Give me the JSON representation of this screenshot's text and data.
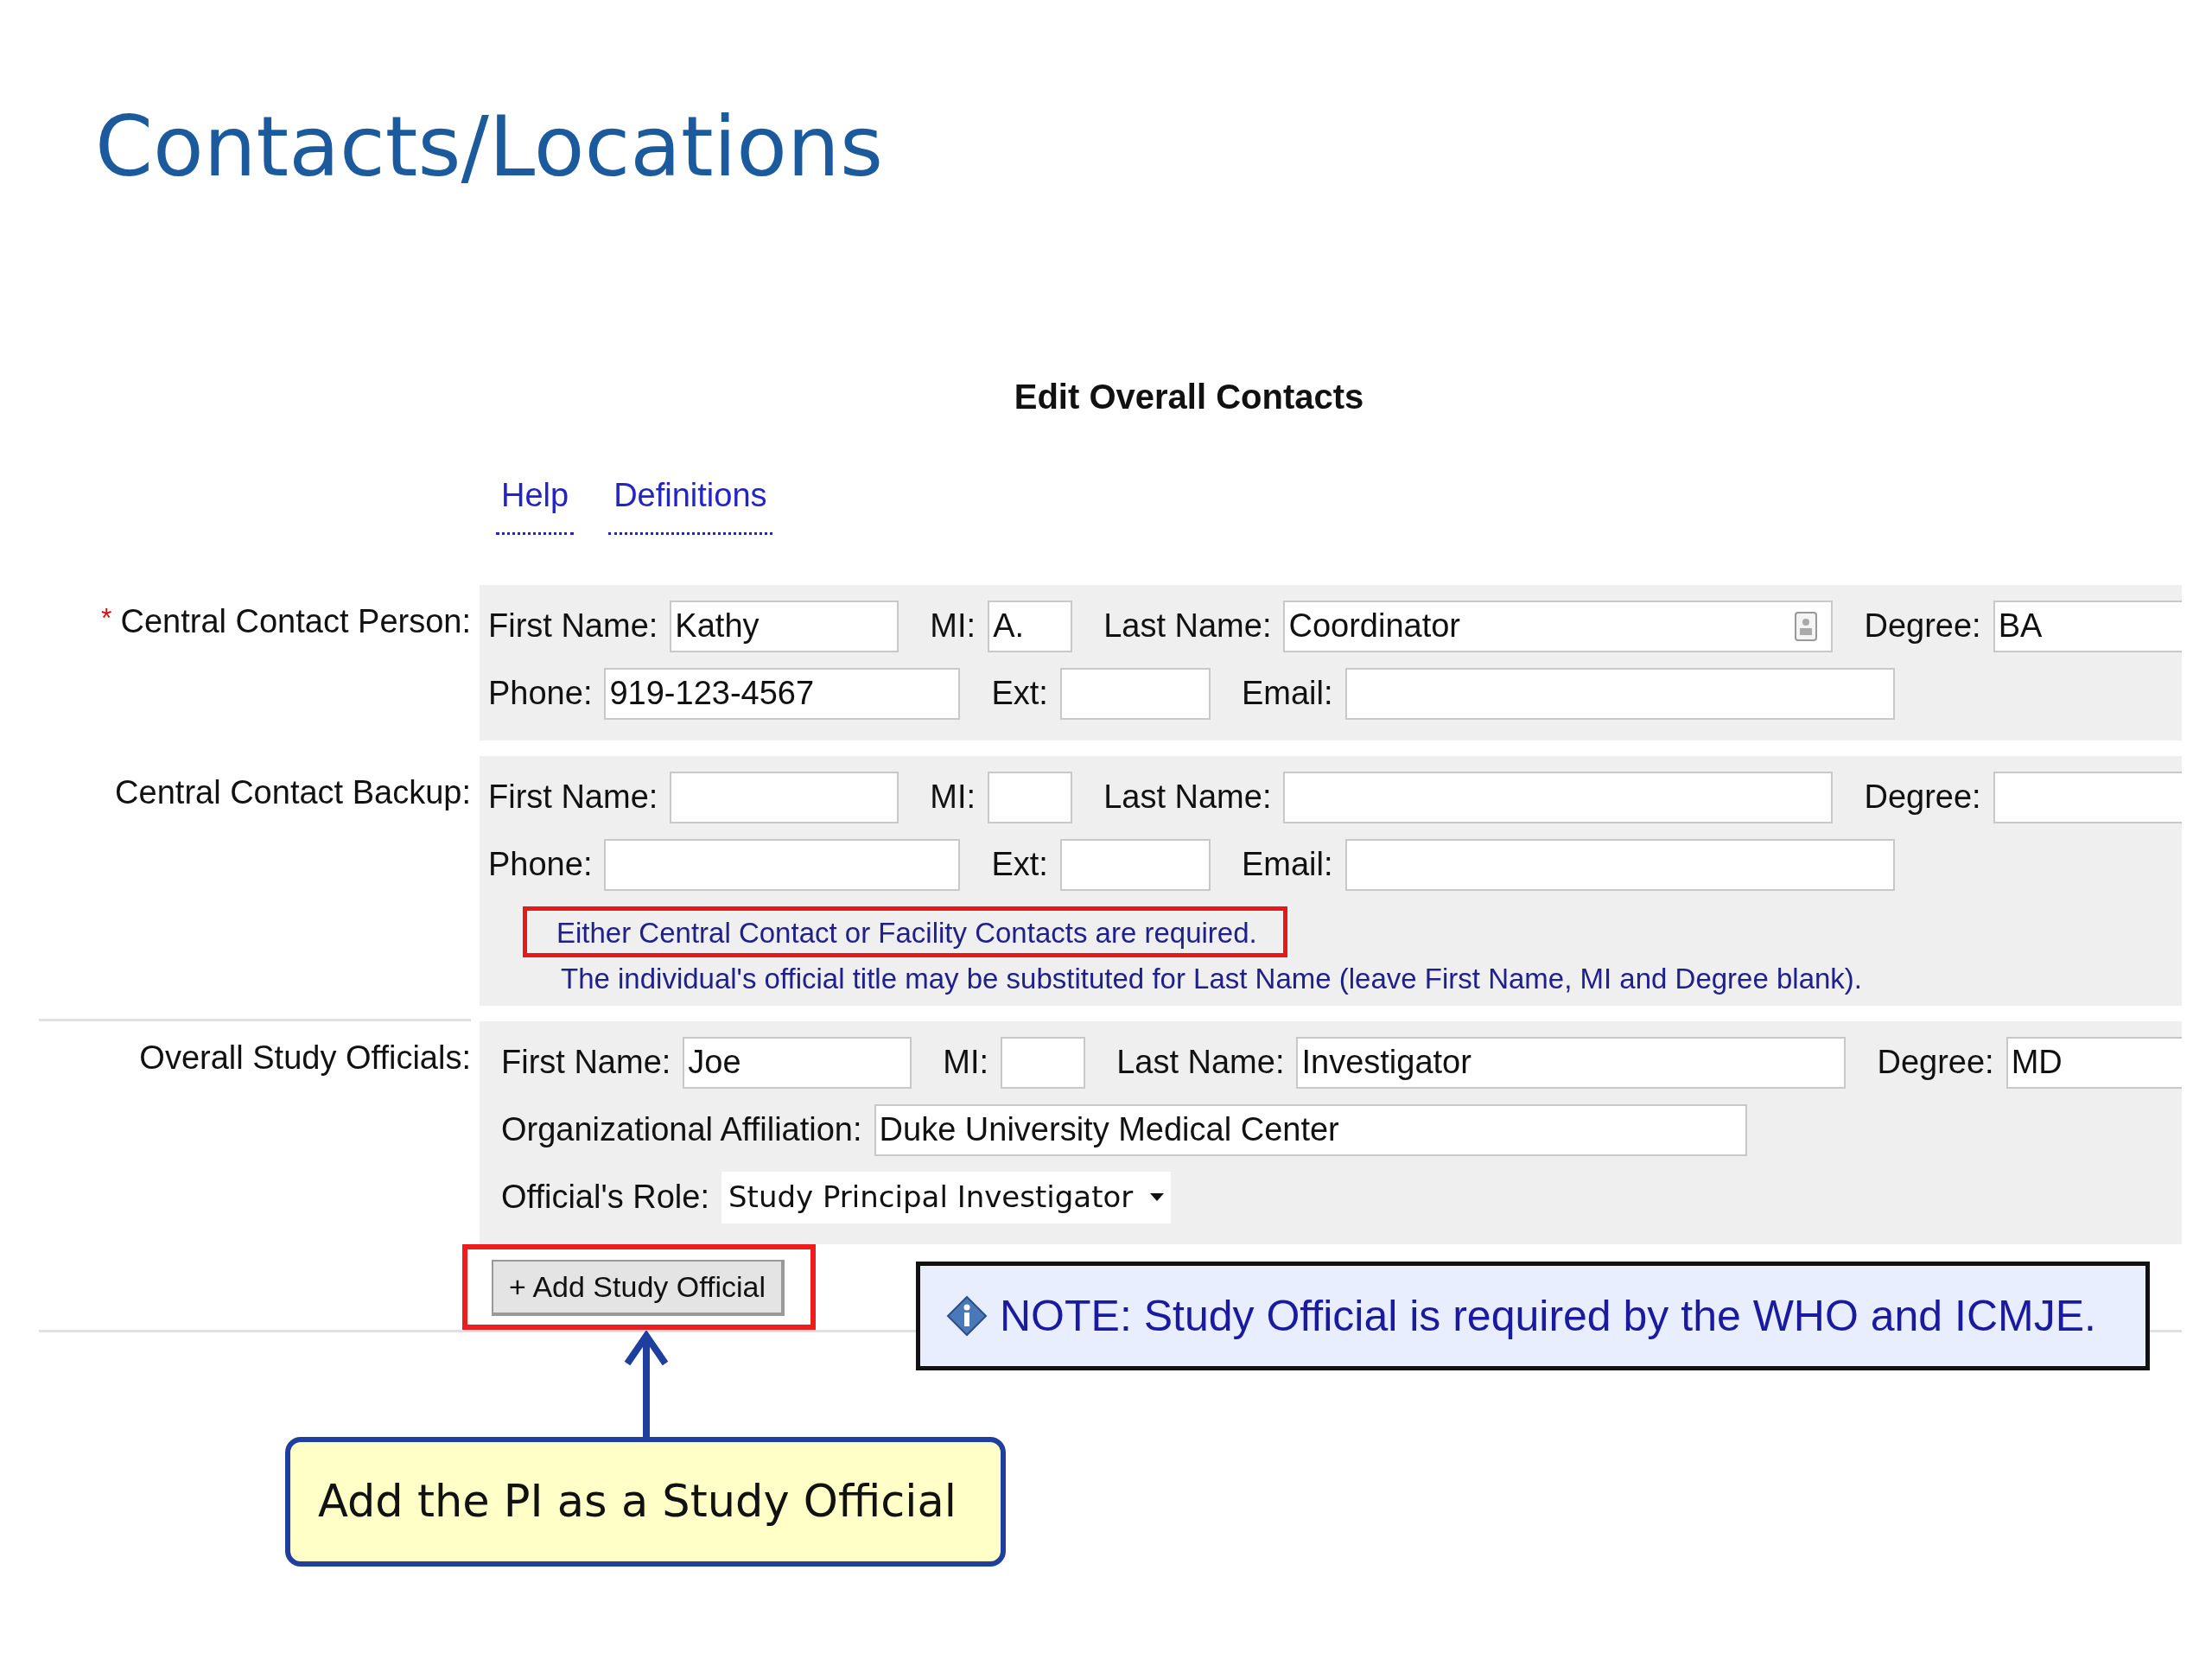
{
  "slide": {
    "title": "Contacts/Locations"
  },
  "form": {
    "heading": "Edit Overall Contacts",
    "links": [
      {
        "label": "Help"
      },
      {
        "label": "Definitions"
      }
    ],
    "sections": [
      {
        "label": "Central Contact Person:",
        "required_mark": "*",
        "rows": [
          [
            {
              "label": "First Name:",
              "kind": "first",
              "value": "Kathy"
            },
            {
              "label": "MI:",
              "kind": "mi",
              "value": "A."
            },
            {
              "label": "Last Name:",
              "kind": "last",
              "value": "Coordinator",
              "card_icon": true
            },
            {
              "label": "Degree:",
              "kind": "degree",
              "value": "BA"
            }
          ],
          [
            {
              "label": "Phone:",
              "kind": "phone",
              "value": "919-123-4567"
            },
            {
              "label": "Ext:",
              "kind": "ext"
            },
            {
              "label": "Email:",
              "kind": "email"
            }
          ]
        ]
      },
      {
        "label": "Central Contact Backup:",
        "rows": [
          [
            {
              "label": "First Name:",
              "kind": "first"
            },
            {
              "label": "MI:",
              "kind": "mi"
            },
            {
              "label": "Last Name:",
              "kind": "last",
              "card_icon": false
            },
            {
              "label": "Degree:",
              "kind": "degree"
            }
          ],
          [
            {
              "label": "Phone:",
              "kind": "phone"
            },
            {
              "label": "Ext:",
              "kind": "ext"
            },
            {
              "label": "Email:",
              "kind": "email"
            }
          ]
        ],
        "notes": [
          {
            "text": "Either Central Contact or Facility Contacts are required.",
            "highlighted": true
          },
          {
            "text": "The individual's official title may be substituted for Last Name (leave First Name, MI and Degree blank).",
            "highlighted": false
          }
        ]
      },
      {
        "label": "Overall Study Officials:",
        "rows": [
          [
            {
              "label": "First Name:",
              "kind": "first",
              "value": "Joe"
            },
            {
              "label": "MI:",
              "kind": "mi"
            },
            {
              "label": "Last Name:",
              "kind": "last",
              "value": "Investigator",
              "card_icon": false
            },
            {
              "label": "Degree:",
              "kind": "degree",
              "value": "MD"
            }
          ],
          [
            {
              "label": "Organizational Affiliation:",
              "kind": "org",
              "value": "Duke University Medical Center"
            }
          ],
          [
            {
              "label": "Official's Role:",
              "kind": "select",
              "value": "Study Principal Investigator"
            }
          ]
        ]
      }
    ],
    "add_button": {
      "label": "+ Add Study Official",
      "highlighted": true
    }
  },
  "note": {
    "text": "NOTE: Study Official is required by the WHO and ICMJE."
  },
  "callout": {
    "text": "Add the PI as a Study Official"
  }
}
